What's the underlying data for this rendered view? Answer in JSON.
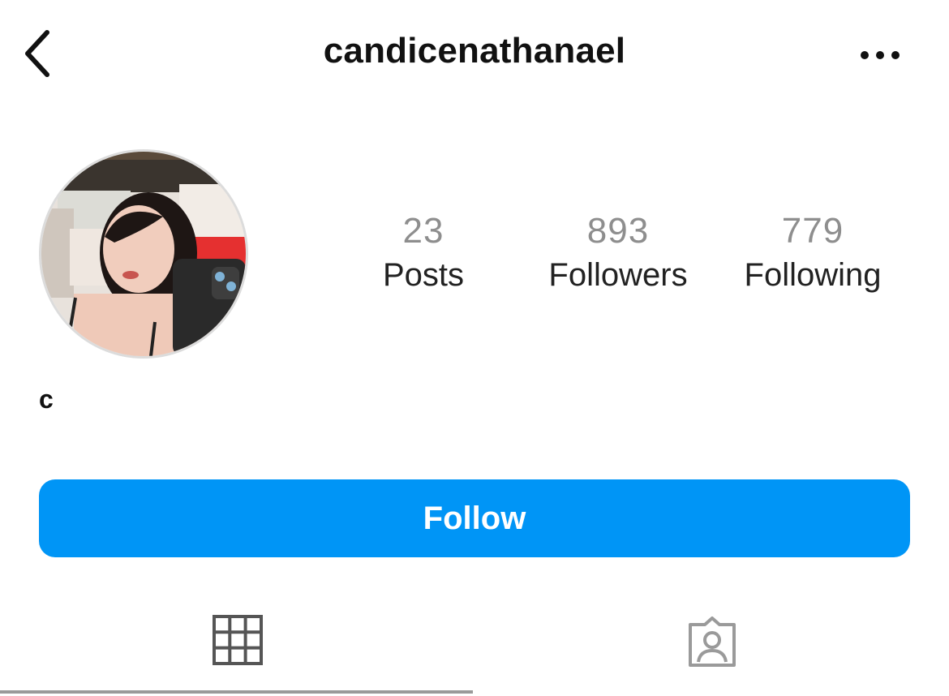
{
  "header": {
    "username": "candicenathanael",
    "back_icon": "chevron-left-icon",
    "more_icon": "more-horizontal-icon"
  },
  "profile": {
    "display_name": "c",
    "avatar": "profile-photo"
  },
  "stats": {
    "posts": {
      "count": "23",
      "label": "Posts"
    },
    "followers": {
      "count": "893",
      "label": "Followers"
    },
    "following": {
      "count": "779",
      "label": "Following"
    }
  },
  "actions": {
    "follow_label": "Follow"
  },
  "tabs": [
    {
      "icon": "grid-icon",
      "selected": true
    },
    {
      "icon": "tagged-person-icon",
      "selected": false
    }
  ],
  "colors": {
    "accent": "#0095f6",
    "text_primary": "#111111",
    "text_muted": "#8e8e8e",
    "background": "#ffffff"
  }
}
